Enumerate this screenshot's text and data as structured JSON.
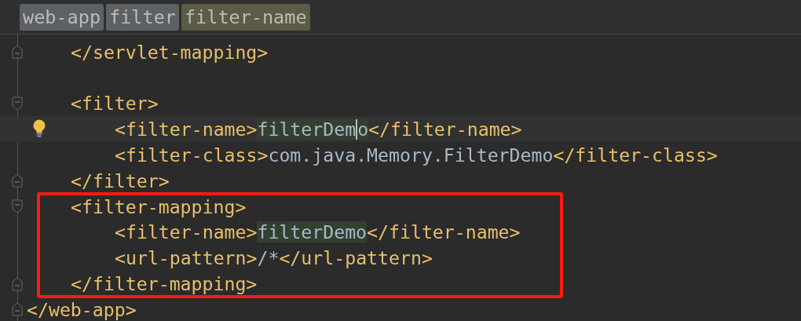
{
  "breadcrumbs": [
    {
      "label": "web-app",
      "selected": false
    },
    {
      "label": "filter",
      "selected": false
    },
    {
      "label": "filter-name",
      "selected": true
    }
  ],
  "code": {
    "children": [
      {
        "kind": "close",
        "tokens": [
          {
            "kind": "tag",
            "text": "</servlet-mapping>"
          }
        ]
      },
      {
        "kind": "open",
        "blank_line_before": true,
        "tokens": [
          {
            "kind": "tag",
            "text": "<filter>"
          }
        ],
        "children": [
          {
            "current": true,
            "hint": true,
            "tokens": [
              {
                "kind": "tag",
                "text": "<filter-name>"
              },
              {
                "kind": "value",
                "text": "filterDem",
                "highlight": true,
                "caret": true
              },
              {
                "kind": "value",
                "text": "o",
                "highlight": true,
                "caret": false
              },
              {
                "kind": "tag",
                "text": "</filter-name>"
              }
            ]
          },
          {
            "tokens": [
              {
                "kind": "tag",
                "text": "<filter-class>"
              },
              {
                "kind": "value",
                "text": "com.java.Memory.FilterDemo"
              },
              {
                "kind": "tag",
                "text": "</filter-class>"
              }
            ]
          }
        ]
      },
      {
        "kind": "close",
        "tokens": [
          {
            "kind": "tag",
            "text": "</filter>"
          }
        ]
      },
      {
        "kind": "open",
        "annotated": true,
        "tokens": [
          {
            "kind": "tag",
            "text": "<filter-mapping>"
          }
        ],
        "children": [
          {
            "tokens": [
              {
                "kind": "tag",
                "text": "<filter-name>"
              },
              {
                "kind": "value",
                "text": "filterDemo",
                "highlight": true
              },
              {
                "kind": "tag",
                "text": "</filter-name>"
              }
            ]
          },
          {
            "tokens": [
              {
                "kind": "tag",
                "text": "<url-pattern>"
              },
              {
                "kind": "value",
                "text": "/*"
              },
              {
                "kind": "tag",
                "text": "</url-pattern>"
              }
            ]
          }
        ],
        "closing": {
          "kind": "close",
          "tokens": [
            {
              "kind": "tag",
              "text": "</filter-mapping>"
            }
          ]
        }
      }
    ],
    "closing": {
      "kind": "close",
      "tokens": [
        {
          "kind": "tag",
          "text": "</web-app>"
        }
      ]
    }
  }
}
